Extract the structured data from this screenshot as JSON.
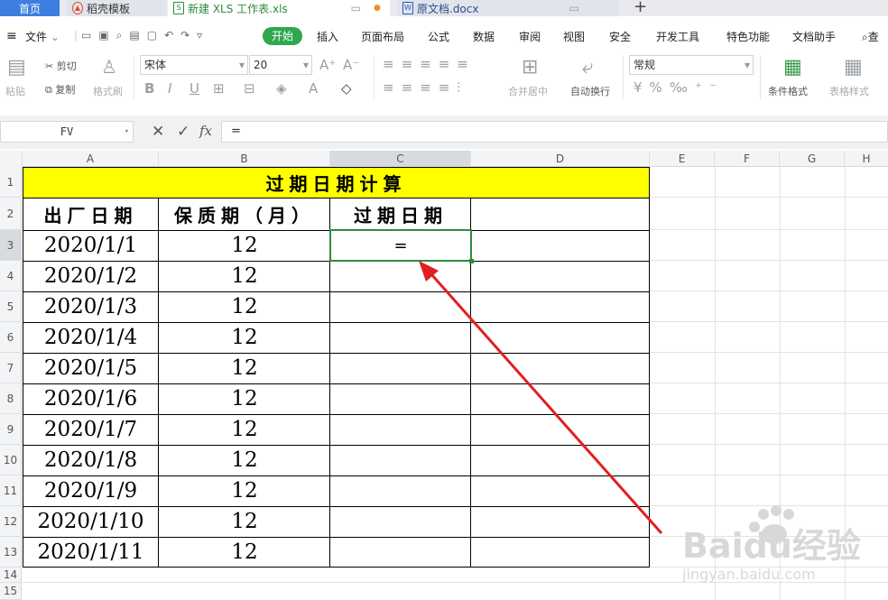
{
  "tabs": {
    "home": "首页",
    "template": "稻壳模板",
    "xls": "新建 XLS 工作表.xls",
    "docx": "原文档.docx",
    "new_tab": "+"
  },
  "menu": {
    "file": "文件",
    "items": [
      "开始",
      "插入",
      "页面布局",
      "公式",
      "数据",
      "审阅",
      "视图",
      "安全",
      "开发工具",
      "特色功能",
      "文档助手"
    ],
    "search": "查"
  },
  "ribbon": {
    "paste": "粘贴",
    "cut": "剪切",
    "copy": "复制",
    "format_painter": "格式刷",
    "font_name": "宋体",
    "font_size": "20",
    "merge": "合并居中",
    "wrap": "自动换行",
    "number_format": "常规",
    "conditional": "条件格式",
    "table_style": "表格样式"
  },
  "formula_bar": {
    "name_box": "FV",
    "formula": "="
  },
  "columns": [
    "A",
    "B",
    "C",
    "D",
    "E",
    "F",
    "G",
    "H"
  ],
  "rows": [
    "1",
    "2",
    "3",
    "4",
    "5",
    "6",
    "7",
    "8",
    "9",
    "10",
    "11",
    "12",
    "13",
    "14",
    "15"
  ],
  "sheet": {
    "title": "过期日期计算",
    "headers": [
      "出厂日期",
      "保质期（月）",
      "过期日期"
    ],
    "data": [
      {
        "date": "2020/1/1",
        "months": "12",
        "expiry": "="
      },
      {
        "date": "2020/1/2",
        "months": "12",
        "expiry": ""
      },
      {
        "date": "2020/1/3",
        "months": "12",
        "expiry": ""
      },
      {
        "date": "2020/1/4",
        "months": "12",
        "expiry": ""
      },
      {
        "date": "2020/1/5",
        "months": "12",
        "expiry": ""
      },
      {
        "date": "2020/1/6",
        "months": "12",
        "expiry": ""
      },
      {
        "date": "2020/1/7",
        "months": "12",
        "expiry": ""
      },
      {
        "date": "2020/1/8",
        "months": "12",
        "expiry": ""
      },
      {
        "date": "2020/1/9",
        "months": "12",
        "expiry": ""
      },
      {
        "date": "2020/1/10",
        "months": "12",
        "expiry": ""
      },
      {
        "date": "2020/1/11",
        "months": "12",
        "expiry": ""
      }
    ]
  },
  "watermark": {
    "text": "Baidu经验",
    "url": "jingyan.baidu.com"
  },
  "colors": {
    "accent": "#2fa84f",
    "title_fill": "#ffff00",
    "arrow": "#e02020",
    "selection": "#2e8b3e"
  }
}
